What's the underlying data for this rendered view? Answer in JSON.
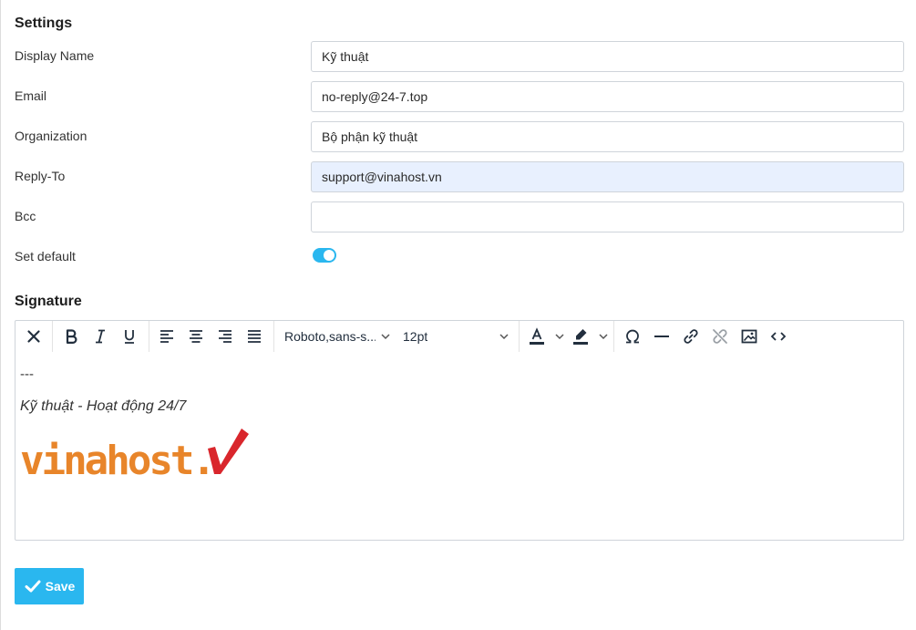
{
  "settings": {
    "title": "Settings",
    "fields": {
      "display_name": {
        "label": "Display Name",
        "value": "Kỹ thuật"
      },
      "email": {
        "label": "Email",
        "value": "no-reply@24-7.top"
      },
      "organization": {
        "label": "Organization",
        "value": "Bộ phận kỹ thuật"
      },
      "reply_to": {
        "label": "Reply-To",
        "value": "support@vinahost.vn"
      },
      "bcc": {
        "label": "Bcc",
        "value": ""
      },
      "set_default": {
        "label": "Set default",
        "checked": true
      }
    }
  },
  "signature": {
    "title": "Signature",
    "toolbar": {
      "font_family": "Roboto,sans-s...",
      "font_size": "12pt",
      "buttons": [
        "clear-formatting",
        "bold",
        "italic",
        "underline",
        "align-left",
        "align-center",
        "align-right",
        "justify",
        "text-color",
        "highlight-color",
        "special-character",
        "horizontal-line",
        "link",
        "unlink",
        "image",
        "source-code"
      ]
    },
    "content": {
      "separator": "---",
      "line": "Kỹ thuật - Hoạt động 24/7",
      "logo_text": "vinahost."
    }
  },
  "actions": {
    "save_label": "Save"
  },
  "colors": {
    "accent": "#2ab7ef",
    "logo_orange": "#e8852a",
    "logo_red": "#d9262c",
    "autofill_bg": "#e8f0fe"
  }
}
